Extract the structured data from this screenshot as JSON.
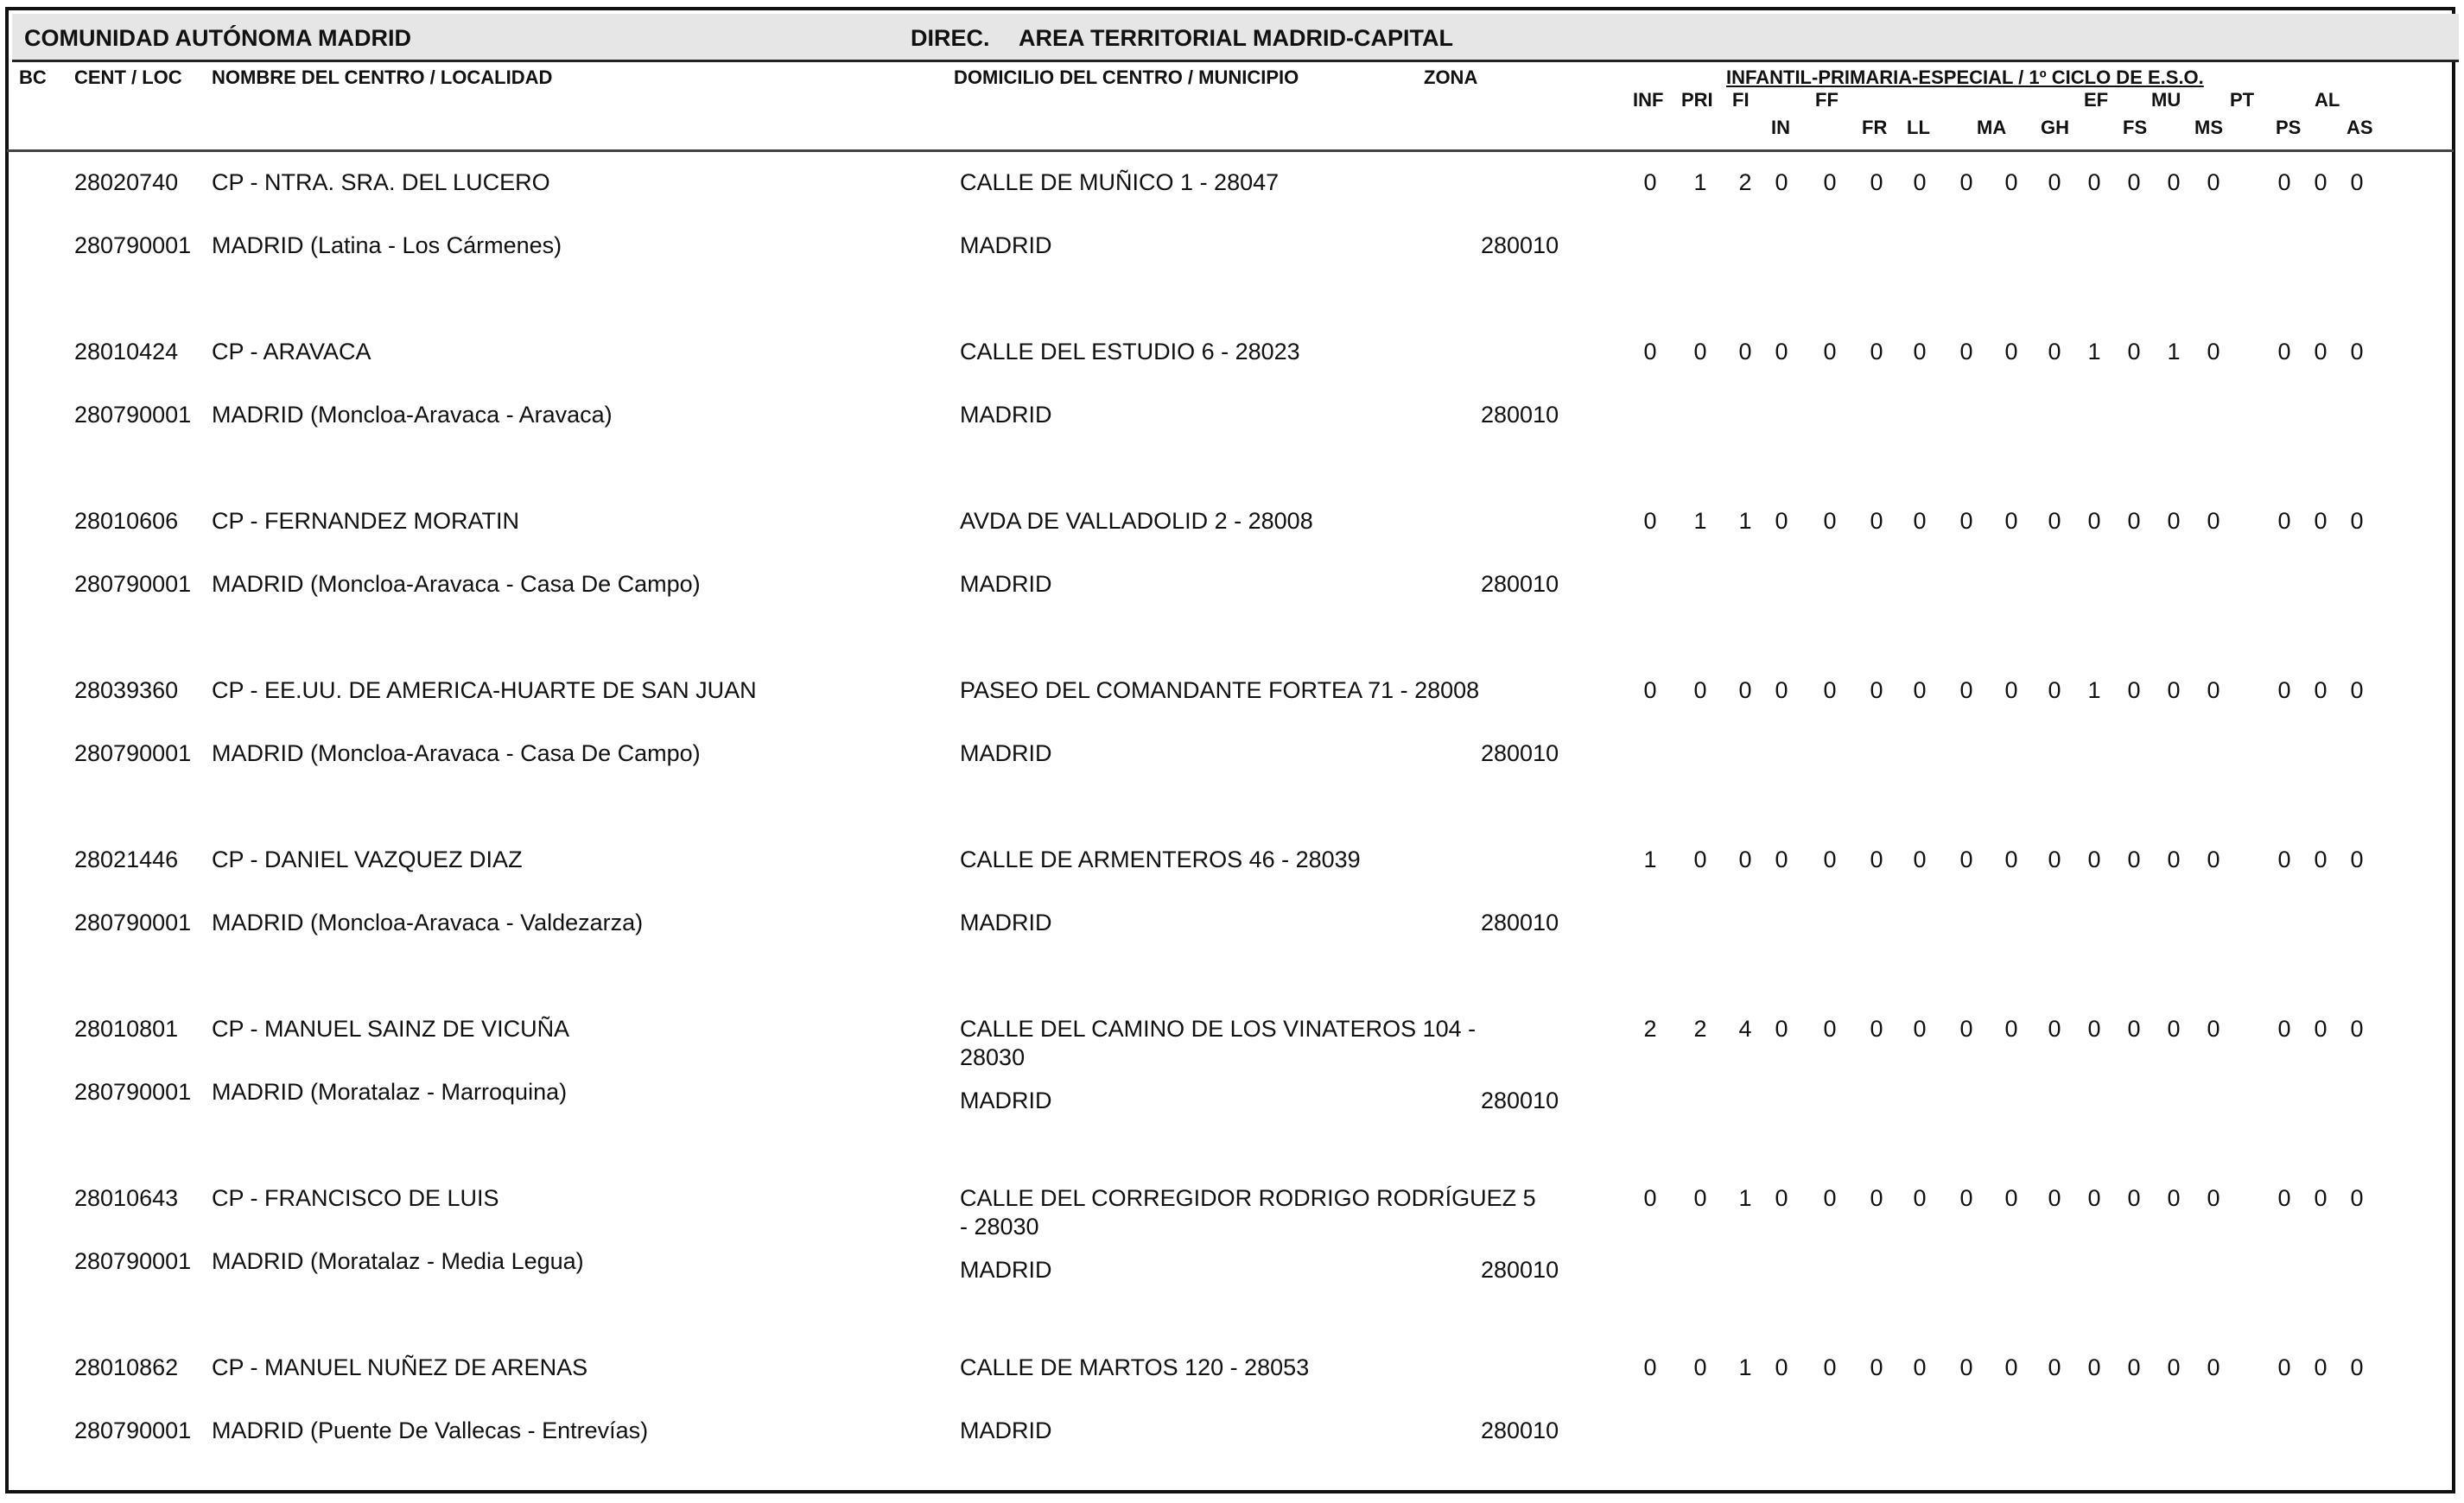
{
  "header": {
    "region": "COMUNIDAD AUTÓNOMA MADRID",
    "direc_label": "DIREC.",
    "direc_value": "AREA TERRITORIAL MADRID-CAPITAL"
  },
  "columns": {
    "bc": "BC",
    "cent_loc": "CENT / LOC",
    "nombre": "NOMBRE DEL CENTRO / LOCALIDAD",
    "domicilio": "DOMICILIO DEL CENTRO / MUNICIPIO",
    "zona": "ZONA",
    "group_title": "INFANTIL-PRIMARIA-ESPECIAL / 1º CICLO DE E.S.O.",
    "codes": [
      "INF",
      "PRI",
      "FI",
      "IN",
      "FF",
      "FR",
      "LL",
      "MA",
      "GH",
      "EF",
      "FS",
      "MU",
      "MS",
      "PT",
      "PS",
      "AL",
      "AS"
    ]
  },
  "rows": [
    {
      "cent": "28020740",
      "nombre": "CP - NTRA. SRA. DEL LUCERO",
      "domicilio": [
        "CALLE DE MUÑICO 1 - 28047"
      ],
      "loc": "280790001",
      "localidad": "MADRID (Latina - Los Cármenes)",
      "municipio": "MADRID",
      "zona": "280010",
      "values": [
        "0",
        "1",
        "2",
        "0",
        "0",
        "0",
        "0",
        "0",
        "0",
        "0",
        "0",
        "0",
        "0",
        "0",
        "0",
        "0",
        "0"
      ]
    },
    {
      "cent": "28010424",
      "nombre": "CP - ARAVACA",
      "domicilio": [
        "CALLE DEL ESTUDIO 6 - 28023"
      ],
      "loc": "280790001",
      "localidad": "MADRID (Moncloa-Aravaca - Aravaca)",
      "municipio": "MADRID",
      "zona": "280010",
      "values": [
        "0",
        "0",
        "0",
        "0",
        "0",
        "0",
        "0",
        "0",
        "0",
        "0",
        "1",
        "0",
        "1",
        "0",
        "0",
        "0",
        "0"
      ]
    },
    {
      "cent": "28010606",
      "nombre": "CP - FERNANDEZ MORATIN",
      "domicilio": [
        "AVDA DE VALLADOLID 2 - 28008"
      ],
      "loc": "280790001",
      "localidad": "MADRID (Moncloa-Aravaca - Casa De Campo)",
      "municipio": "MADRID",
      "zona": "280010",
      "values": [
        "0",
        "1",
        "1",
        "0",
        "0",
        "0",
        "0",
        "0",
        "0",
        "0",
        "0",
        "0",
        "0",
        "0",
        "0",
        "0",
        "0"
      ]
    },
    {
      "cent": "28039360",
      "nombre": "CP - EE.UU. DE AMERICA-HUARTE DE SAN JUAN",
      "domicilio": [
        "PASEO DEL COMANDANTE FORTEA 71 - 28008"
      ],
      "loc": "280790001",
      "localidad": "MADRID (Moncloa-Aravaca - Casa De Campo)",
      "municipio": "MADRID",
      "zona": "280010",
      "values": [
        "0",
        "0",
        "0",
        "0",
        "0",
        "0",
        "0",
        "0",
        "0",
        "0",
        "1",
        "0",
        "0",
        "0",
        "0",
        "0",
        "0"
      ]
    },
    {
      "cent": "28021446",
      "nombre": "CP - DANIEL VAZQUEZ DIAZ",
      "domicilio": [
        "CALLE DE ARMENTEROS 46 - 28039"
      ],
      "loc": "280790001",
      "localidad": "MADRID (Moncloa-Aravaca - Valdezarza)",
      "municipio": "MADRID",
      "zona": "280010",
      "values": [
        "1",
        "0",
        "0",
        "0",
        "0",
        "0",
        "0",
        "0",
        "0",
        "0",
        "0",
        "0",
        "0",
        "0",
        "0",
        "0",
        "0"
      ]
    },
    {
      "cent": "28010801",
      "nombre": "CP - MANUEL SAINZ DE VICUÑA",
      "domicilio": [
        "CALLE DEL CAMINO DE LOS VINATEROS 104 -",
        "28030"
      ],
      "loc": "280790001",
      "localidad": "MADRID (Moratalaz - Marroquina)",
      "municipio": "MADRID",
      "zona": "280010",
      "values": [
        "2",
        "2",
        "4",
        "0",
        "0",
        "0",
        "0",
        "0",
        "0",
        "0",
        "0",
        "0",
        "0",
        "0",
        "0",
        "0",
        "0"
      ]
    },
    {
      "cent": "28010643",
      "nombre": "CP - FRANCISCO DE LUIS",
      "domicilio": [
        "CALLE DEL CORREGIDOR RODRIGO RODRÍGUEZ 5",
        "- 28030"
      ],
      "loc": "280790001",
      "localidad": "MADRID (Moratalaz - Media Legua)",
      "municipio": "MADRID",
      "zona": "280010",
      "values": [
        "0",
        "0",
        "1",
        "0",
        "0",
        "0",
        "0",
        "0",
        "0",
        "0",
        "0",
        "0",
        "0",
        "0",
        "0",
        "0",
        "0"
      ]
    },
    {
      "cent": "28010862",
      "nombre": "CP - MANUEL NUÑEZ DE ARENAS",
      "domicilio": [
        "CALLE DE MARTOS 120 - 28053"
      ],
      "loc": "280790001",
      "localidad": "MADRID (Puente De Vallecas - Entrevías)",
      "municipio": "MADRID",
      "zona": "280010",
      "values": [
        "0",
        "0",
        "1",
        "0",
        "0",
        "0",
        "0",
        "0",
        "0",
        "0",
        "0",
        "0",
        "0",
        "0",
        "0",
        "0",
        "0"
      ]
    }
  ]
}
